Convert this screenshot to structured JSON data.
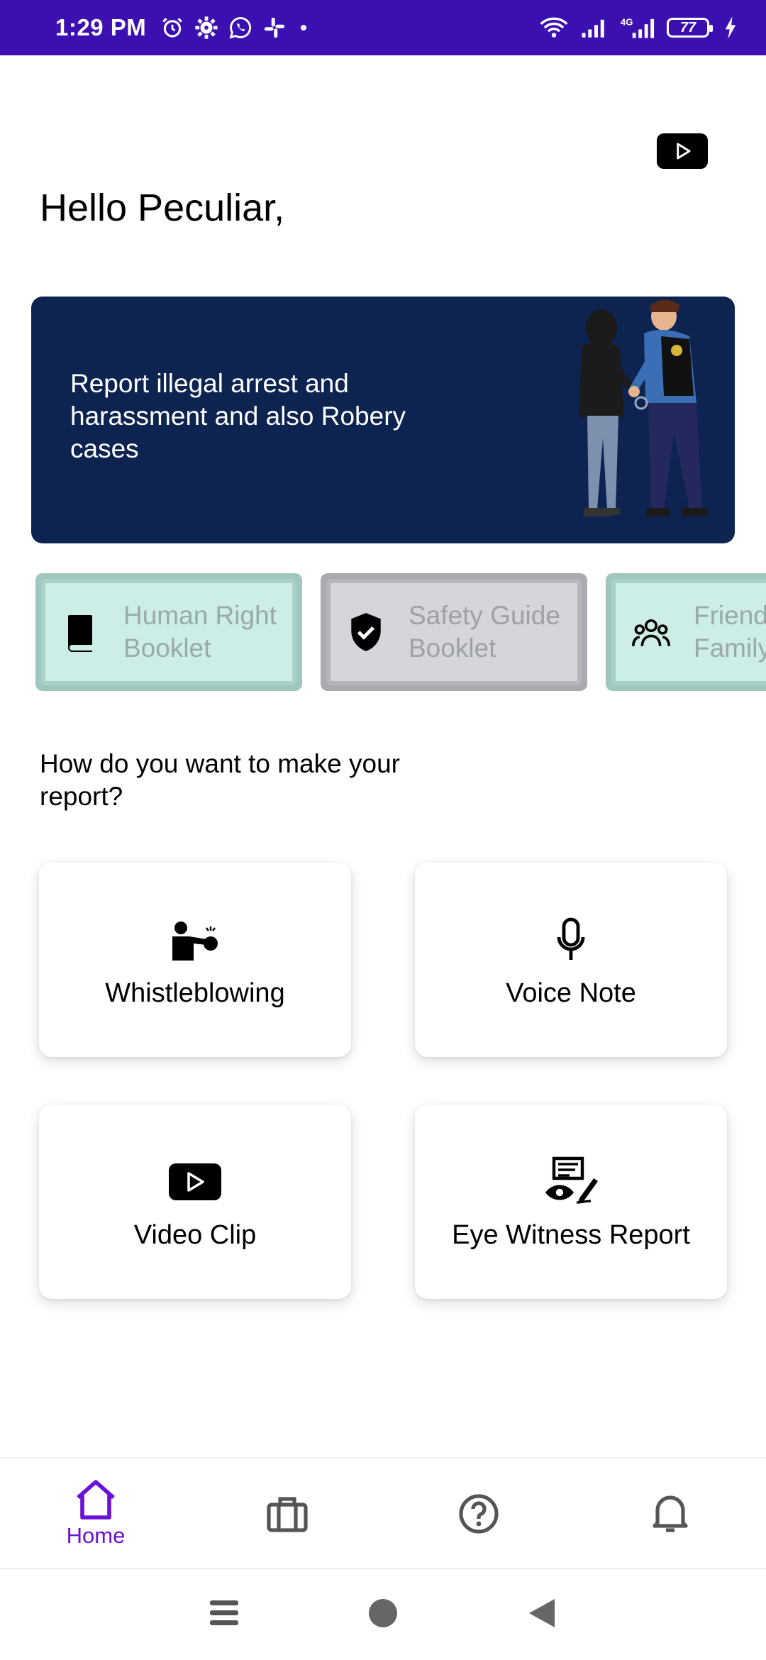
{
  "status_bar": {
    "time": "1:29 PM",
    "icons_left": [
      "alarm-icon",
      "gear-icon",
      "whatsapp-icon",
      "slack-icon"
    ],
    "icons_right": [
      "wifi-icon",
      "signal-icon",
      "signal-4g-icon",
      "battery-icon",
      "charging-icon"
    ],
    "battery_level": "77",
    "network_label": "4G"
  },
  "header": {
    "greeting": "Hello Peculiar,",
    "video_button_icon": "play-icon"
  },
  "banner": {
    "text": "Report illegal arrest and harassment and also Robery cases",
    "background_color": "#0d2350"
  },
  "chips": [
    {
      "label_line1": "Human Right",
      "label_line2": "Booklet",
      "icon": "book-icon"
    },
    {
      "label_line1": "Safety Guide",
      "label_line2": "Booklet",
      "icon": "shield-check-icon"
    },
    {
      "label_line1": "Friends",
      "label_line2": "Family",
      "icon": "people-icon"
    }
  ],
  "question": "How do you want to make your report?",
  "report_options": [
    {
      "label": "Whistleblowing",
      "icon": "whistleblower-icon"
    },
    {
      "label": "Voice Note",
      "icon": "microphone-icon"
    },
    {
      "label": "Video Clip",
      "icon": "video-play-icon"
    },
    {
      "label": "Eye Witness Report",
      "icon": "eye-witness-icon"
    }
  ],
  "bottom_nav": {
    "items": [
      {
        "label": "Home",
        "icon": "home-icon",
        "active": true
      },
      {
        "label": "",
        "icon": "briefcase-icon",
        "active": false
      },
      {
        "label": "",
        "icon": "help-icon",
        "active": false
      },
      {
        "label": "",
        "icon": "bell-icon",
        "active": false
      }
    ],
    "active_color": "#6a11d8"
  },
  "colors": {
    "status_bar": "#3c0fb0",
    "accent": "#6a11d8"
  }
}
